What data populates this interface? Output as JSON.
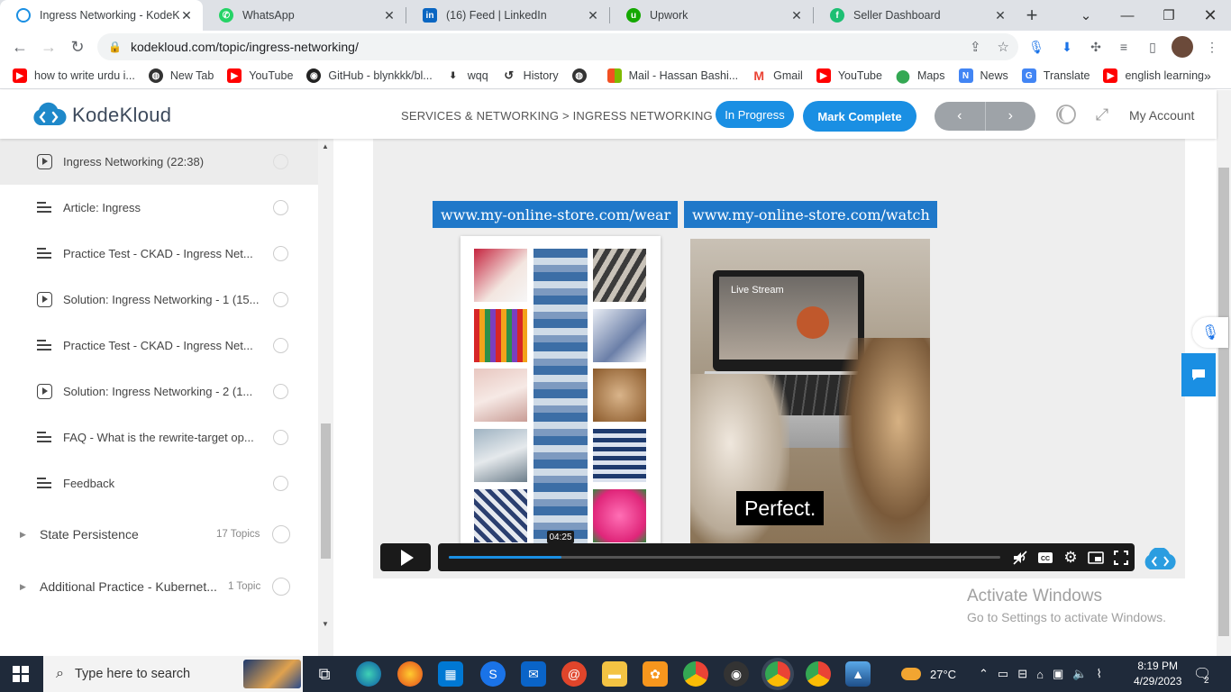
{
  "browser": {
    "tabs": [
      {
        "title": "Ingress Networking - KodeKloud",
        "active": true
      },
      {
        "title": "WhatsApp"
      },
      {
        "title": "(16) Feed | LinkedIn"
      },
      {
        "title": "Upwork"
      },
      {
        "title": "Seller Dashboard"
      }
    ],
    "url": "kodekloud.com/topic/ingress-networking/",
    "bookmarks": [
      "how to write urdu i...",
      "New Tab",
      "YouTube",
      "GitHub - blynkkk/bl...",
      "wqq",
      "History",
      "",
      "Mail - Hassan Bashi...",
      "Gmail",
      "YouTube",
      "Maps",
      "News",
      "Translate",
      "english learning"
    ]
  },
  "header": {
    "logo_text": "KodeKloud",
    "breadcrumb": "SERVICES & NETWORKING > INGRESS NETWORKING",
    "status_pill": "In Progress",
    "mark_complete": "Mark Complete",
    "prev": "‹",
    "next": "›",
    "account": "My Account"
  },
  "sidebar": {
    "lessons": [
      {
        "type": "video",
        "label": "Ingress Networking (22:38)",
        "active": true
      },
      {
        "type": "article",
        "label": "Article: Ingress"
      },
      {
        "type": "article",
        "label": "Practice Test - CKAD - Ingress Net..."
      },
      {
        "type": "video",
        "label": "Solution: Ingress Networking - 1 (15..."
      },
      {
        "type": "article",
        "label": "Practice Test - CKAD - Ingress Net..."
      },
      {
        "type": "video",
        "label": "Solution: Ingress Networking - 2 (1..."
      },
      {
        "type": "article",
        "label": "FAQ - What is the rewrite-target op..."
      },
      {
        "type": "article",
        "label": "Feedback"
      }
    ],
    "sections": [
      {
        "label": "State Persistence",
        "count": "17 Topics"
      },
      {
        "label": "Additional Practice - Kubernet...",
        "count": "1 Topic"
      }
    ]
  },
  "video": {
    "banner_left": "www.my-online-store.com/wear",
    "banner_right": "www.my-online-store.com/watch",
    "screen_text": "Live Stream",
    "caption": "Perfect.",
    "time": "04:25",
    "progress": 0.205
  },
  "watermark": {
    "line1": "Activate Windows",
    "line2": "Go to Settings to activate Windows."
  },
  "taskbar": {
    "search_placeholder": "Type here to search",
    "temperature": "27°C",
    "time": "8:19 PM",
    "date": "4/29/2023",
    "notifications": "2"
  }
}
